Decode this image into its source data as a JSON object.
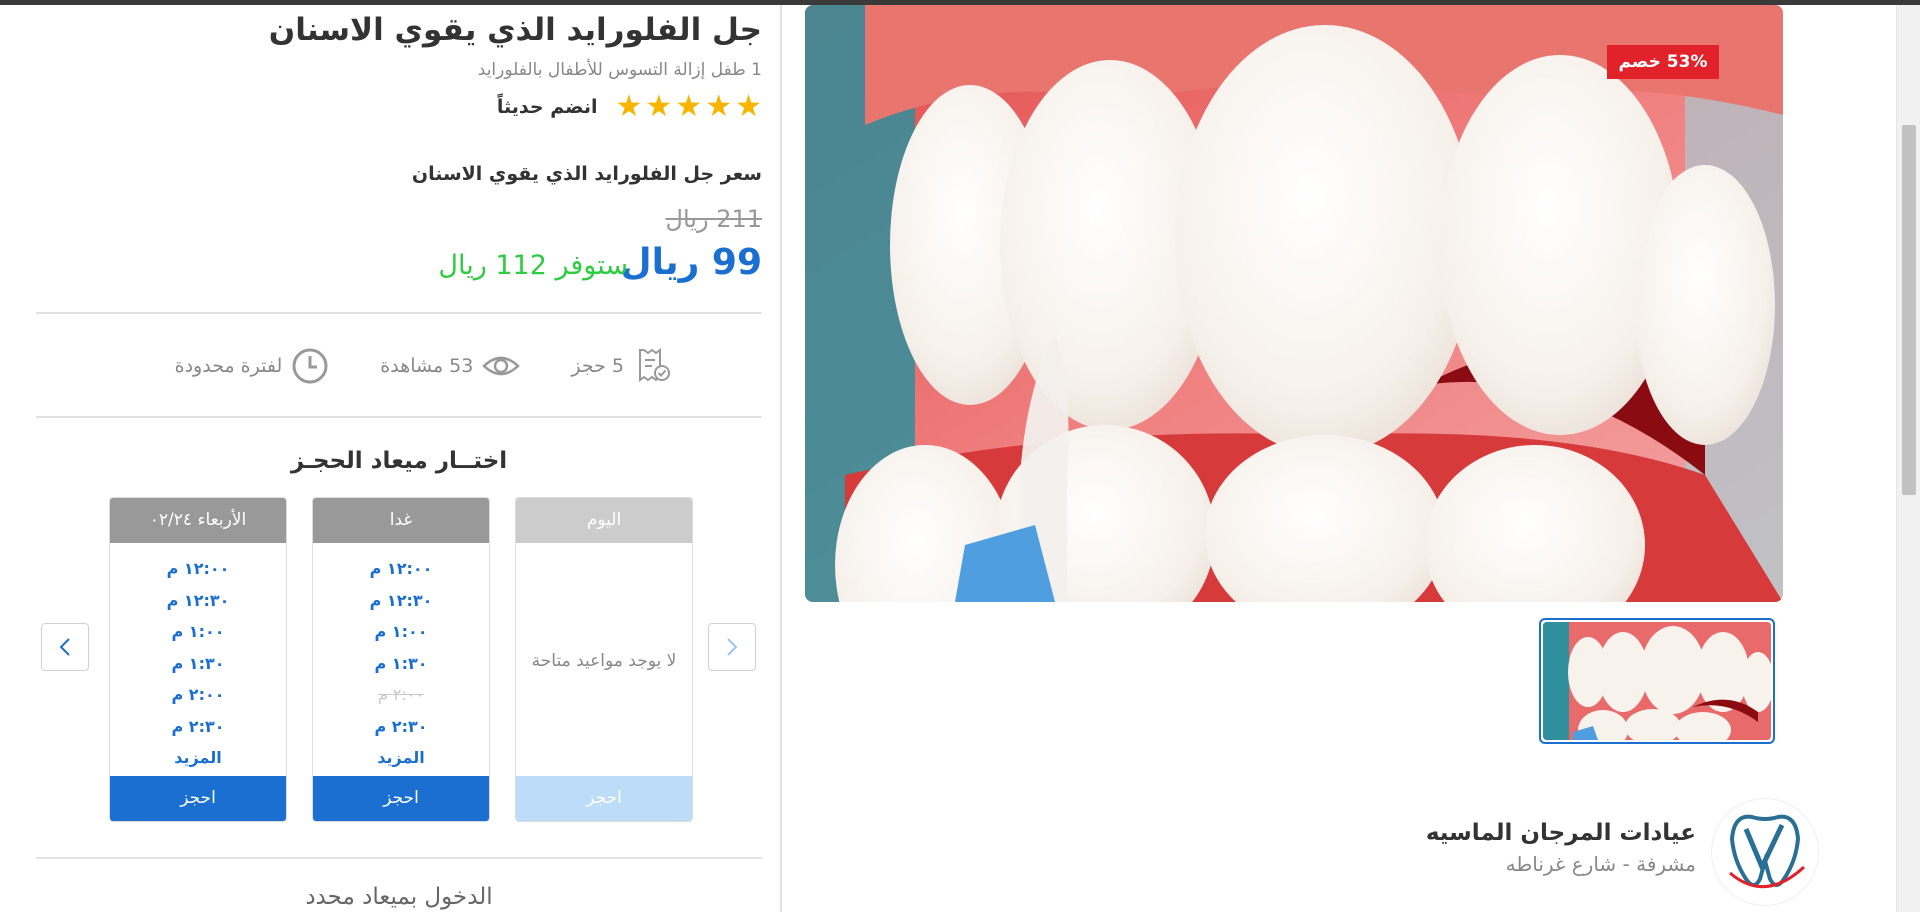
{
  "product": {
    "title": "جل الفلورايد الذي يقوي الاسنان",
    "subtitle": "1 طفل إزالة التسوس للأطفال بالفلورايد",
    "rating": 5,
    "joined_label": "انضم حديثاً"
  },
  "price": {
    "label": "سعر جل الفلورايد الذي يقوي الاسنان",
    "old": "211 ريال",
    "new": "99 ريال",
    "saving": "ستوفر 112 ريال",
    "colors": {
      "new": "#1a6fd0",
      "saving": "#2ecc40"
    }
  },
  "stats": [
    {
      "icon": "receipt-check-icon",
      "text": "5 حجز"
    },
    {
      "icon": "eye-icon",
      "text": "53 مشاهدة"
    },
    {
      "icon": "clock-icon",
      "text": "لفترة محدودة"
    }
  ],
  "booking": {
    "title": "اختــار ميعاد الحجـز",
    "days": [
      {
        "label": "اليوم",
        "empty_text": "لا يوجد مواعيد متاحة",
        "slots": [],
        "button": "احجز",
        "enabled": false
      },
      {
        "label": "غدا",
        "slots": [
          {
            "time": "١٢:٠٠ م",
            "available": true
          },
          {
            "time": "١٢:٣٠ م",
            "available": true
          },
          {
            "time": "١:٠٠ م",
            "available": true
          },
          {
            "time": "١:٣٠ م",
            "available": true
          },
          {
            "time": "٢:٠٠ م",
            "available": false
          },
          {
            "time": "٢:٣٠ م",
            "available": true
          }
        ],
        "more": "المزيد",
        "button": "احجز",
        "enabled": true
      },
      {
        "label": "الأربعاء ٠٢/٢٤",
        "slots": [
          {
            "time": "١٢:٠٠ م",
            "available": true
          },
          {
            "time": "١٢:٣٠ م",
            "available": true
          },
          {
            "time": "١:٠٠ م",
            "available": true
          },
          {
            "time": "١:٣٠ م",
            "available": true
          },
          {
            "time": "٢:٠٠ م",
            "available": true
          },
          {
            "time": "٢:٣٠ م",
            "available": true
          }
        ],
        "more": "المزيد",
        "button": "احجز",
        "enabled": true
      }
    ],
    "walk_in": "الدخول بميعاد محدد"
  },
  "gallery": {
    "discount_badge": "53% خصم"
  },
  "clinic": {
    "name": "عيادات المرجان الماسيه",
    "location": "مشرفة - شارع غرناطه"
  },
  "theme": {
    "accent": "#1a6fd0",
    "star": "#f7b500",
    "badge": "#e1222b",
    "head_active": "#999999",
    "head_disabled": "#cccccc",
    "button_disabled": "#bcdcf8"
  }
}
